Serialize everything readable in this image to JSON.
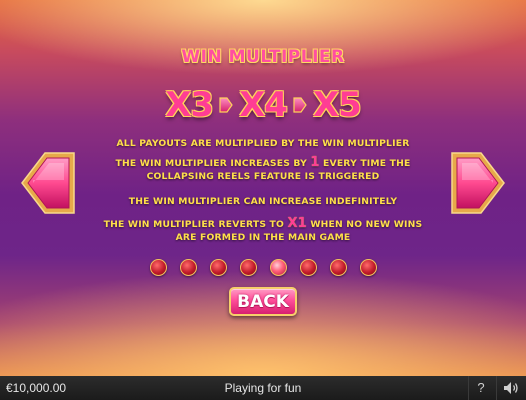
{
  "title": "WIN MULTIPLIER",
  "multipliers": [
    "X3",
    "X4",
    "X5"
  ],
  "lines": {
    "line1": "ALL PAYOUTS ARE MULTIPLIED BY THE WIN MULTIPLIER",
    "line2a": "THE WIN MULTIPLIER INCREASES BY",
    "line2_value": "1",
    "line2b": "EVERY TIME THE",
    "line2c": "COLLAPSING REELS FEATURE IS TRIGGERED",
    "line3": "THE WIN MULTIPLIER CAN INCREASE INDEFINITELY",
    "line4a": "THE WIN MULTIPLIER REVERTS TO",
    "line4_value": "X1",
    "line4b": "WHEN NO NEW WINS",
    "line4c": "ARE FORMED IN THE MAIN GAME"
  },
  "pagination": {
    "total": 8,
    "active_index": 4
  },
  "back_label": "BACK",
  "footer": {
    "balance": "€10,000.00",
    "mode": "Playing for fun",
    "help_label": "?"
  },
  "icons": {
    "prev": "left-gem-arrow-icon",
    "next": "right-gem-arrow-icon",
    "sound": "speaker-icon"
  },
  "colors": {
    "accent_pink": "#ff3d94",
    "text_yellow": "#ffe04a",
    "gold_border": "#f3c25c"
  }
}
